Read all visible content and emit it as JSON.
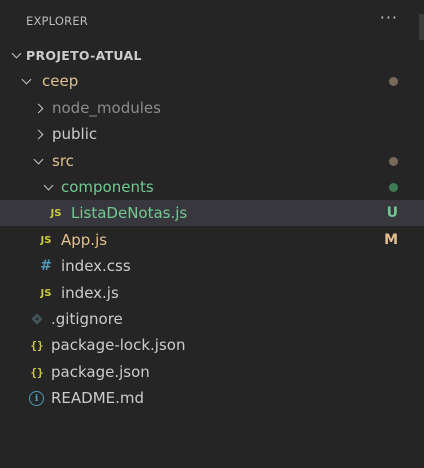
{
  "explorer": {
    "title": "EXPLORER",
    "more_actions": "···"
  },
  "root": {
    "label": "PROJETO-ATUAL"
  },
  "tree": {
    "ceep": {
      "label": "ceep",
      "color": "#e2c08d",
      "dot_color": "#7b6a5a"
    },
    "node_modules": {
      "label": "node_modules",
      "color": "#8c8c8c"
    },
    "public": {
      "label": "public",
      "color": "#cccccc"
    },
    "src": {
      "label": "src",
      "color": "#e2c08d",
      "dot_color": "#7b6a5a"
    },
    "components": {
      "label": "components",
      "color": "#73c991",
      "dot_color": "#3f7a55"
    },
    "lista": {
      "icon": "JS",
      "label": "ListaDeNotas.js",
      "color": "#73c991",
      "badge": "U"
    },
    "app": {
      "icon": "JS",
      "label": "App.js",
      "color": "#e2c08d",
      "badge": "M"
    },
    "index_css": {
      "icon": "#",
      "label": "index.css",
      "color": "#cccccc"
    },
    "index_js": {
      "icon": "JS",
      "label": "index.js",
      "color": "#cccccc"
    },
    "gitignore": {
      "label": ".gitignore",
      "color": "#cccccc"
    },
    "package_lock": {
      "icon": "{}",
      "label": "package-lock.json",
      "color": "#cccccc"
    },
    "package": {
      "icon": "{}",
      "label": "package.json",
      "color": "#cccccc"
    },
    "readme": {
      "icon": "i",
      "label": "README.md",
      "color": "#cccccc"
    }
  }
}
